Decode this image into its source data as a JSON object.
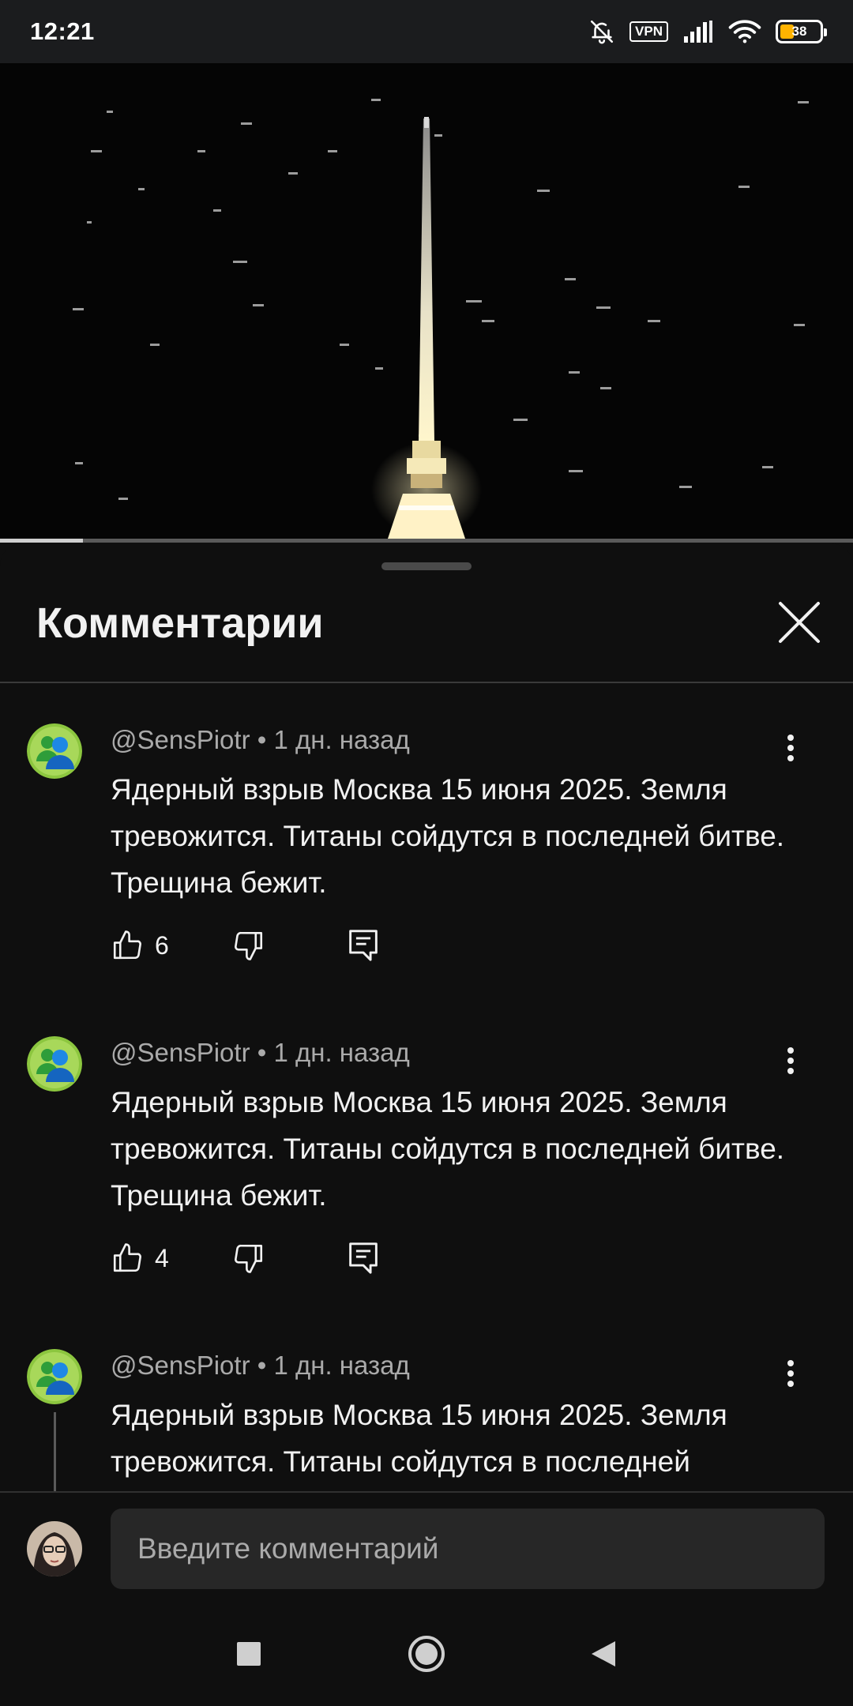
{
  "status_bar": {
    "time": "12:21",
    "vpn": "VPN",
    "battery": "38",
    "icons": [
      "bell-off-icon",
      "vpn-icon",
      "signal-icon",
      "wifi-icon",
      "battery-icon"
    ],
    "battery_color": "#ffb300"
  },
  "video": {
    "progress": 0.097
  },
  "comments_sheet": {
    "title": "Комментарии",
    "close_icon": "close-icon",
    "comments": [
      {
        "author": "@SensPiotr",
        "age": "• 1 дн. назад",
        "text": "Ядерный взрыв Москва 15 июня 2025. Земля тревожится. Титаны сойдутся в последней битве. Трещина бежит.",
        "likes": "6"
      },
      {
        "author": "@SensPiotr",
        "age": "• 1 дн. назад",
        "text": "Ядерный взрыв Москва 15 июня 2025. Земля тревожится. Титаны сойдутся в последней битве. Трещина бежит.",
        "likes": "4"
      },
      {
        "author": "@SensPiotr",
        "age": "• 1 дн. назад",
        "text": "Ядерный взрыв Москва 15 июня 2025. Земля тревожится. Титаны сойдутся в последней"
      }
    ]
  },
  "input": {
    "placeholder": "Введите комментарий"
  },
  "nav_bar": {
    "icons": [
      "recents-square-icon",
      "home-circle-icon",
      "back-triangle-icon"
    ]
  }
}
